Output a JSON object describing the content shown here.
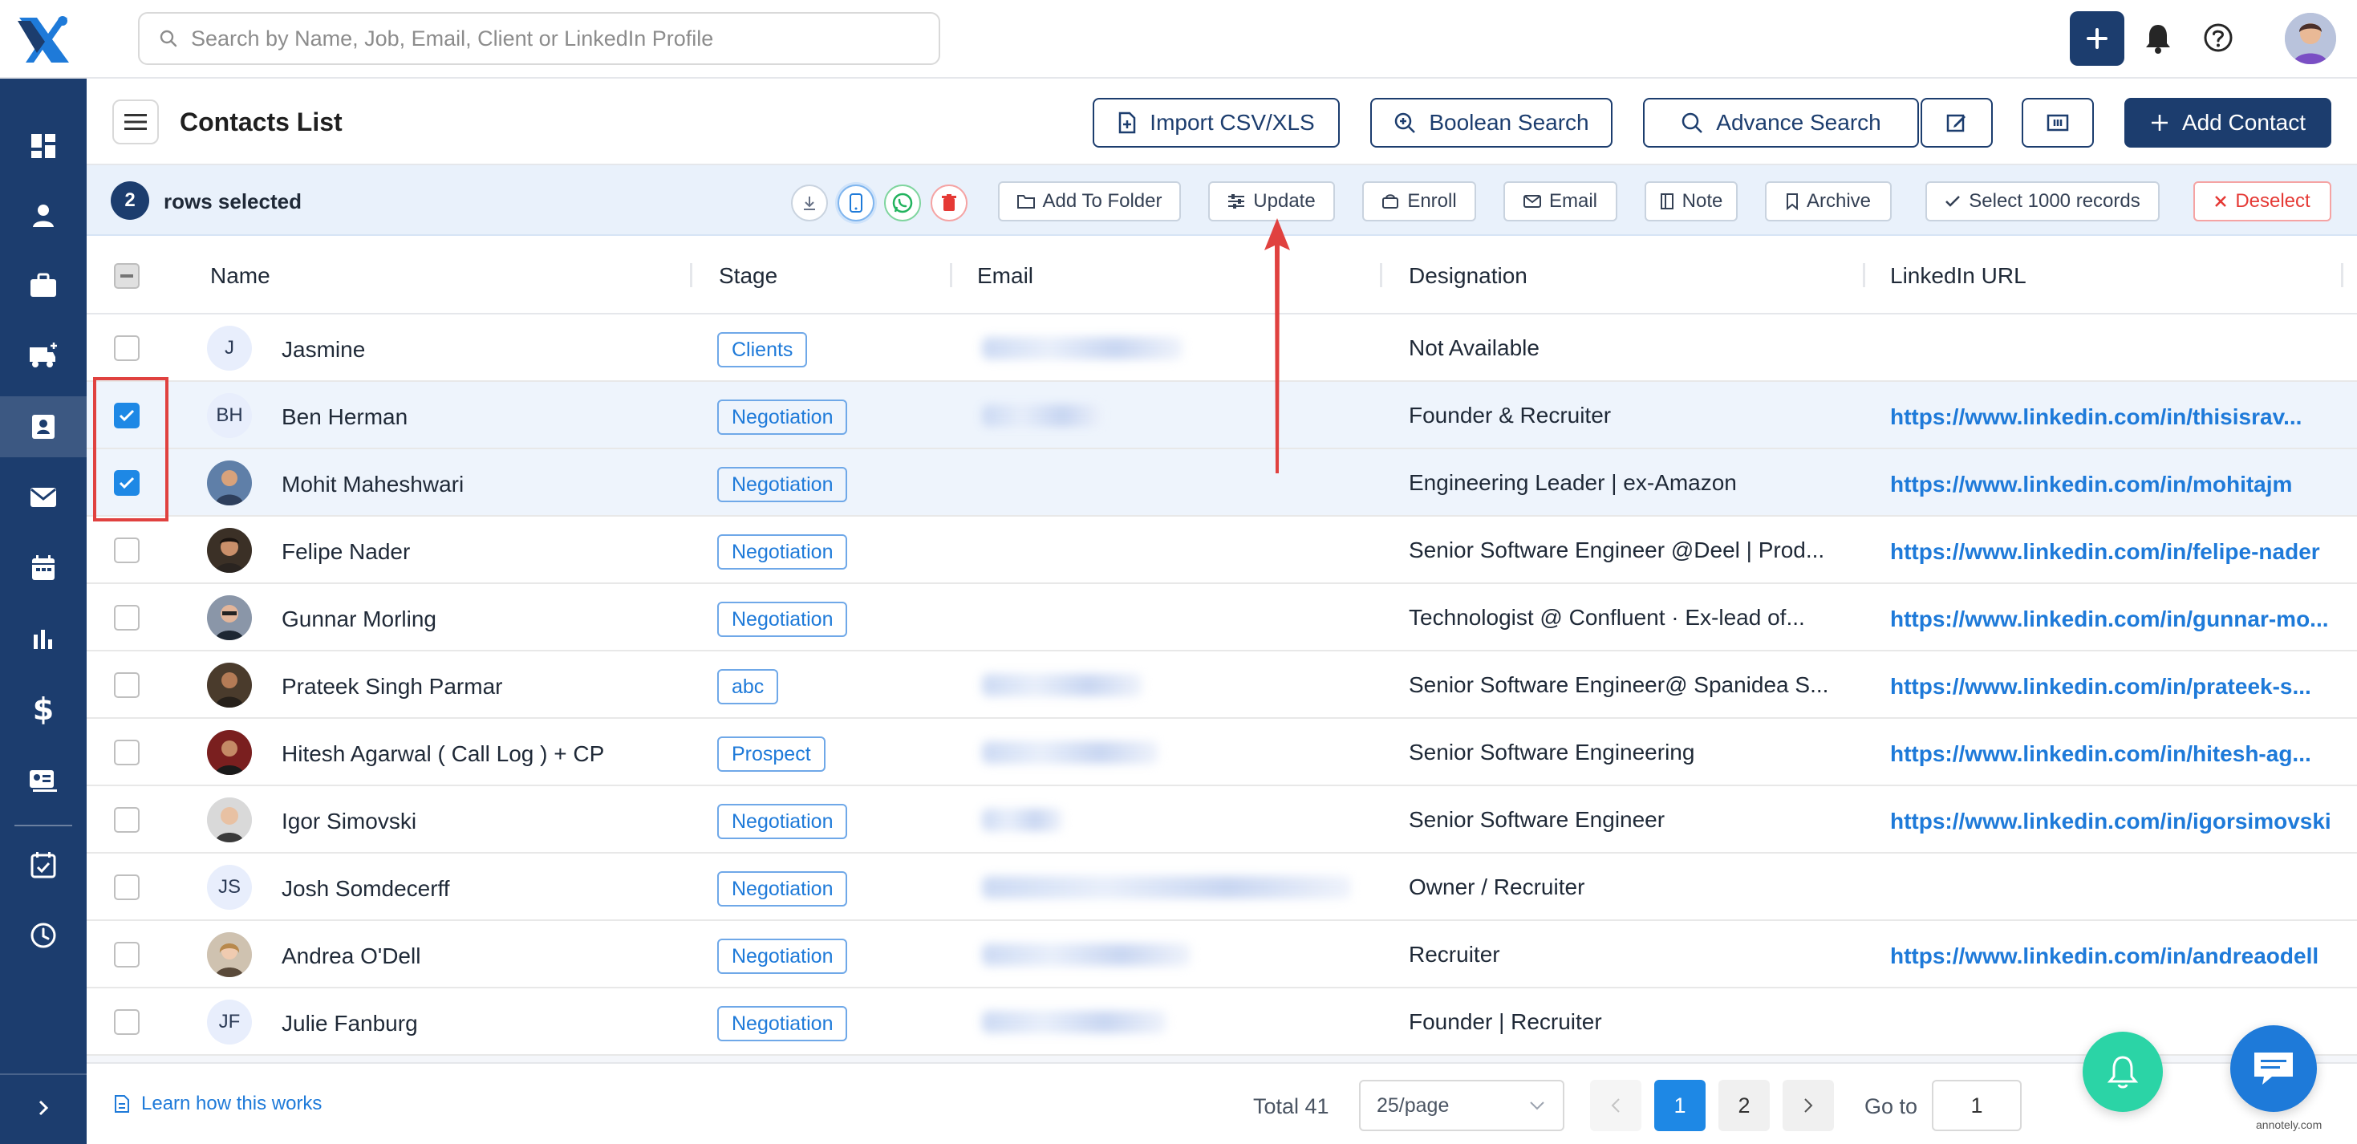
{
  "app": {
    "search_placeholder": "Search by Name, Job, Email, Client or LinkedIn Profile"
  },
  "header": {
    "title": "Contacts List",
    "import_label": "Import CSV/XLS",
    "boolean_label": "Boolean Search",
    "advance_label": "Advance Search",
    "add_contact_label": "Add Contact"
  },
  "selection": {
    "count": "2",
    "text": "rows selected",
    "actions": {
      "add_to_folder": "Add To Folder",
      "update": "Update",
      "enroll": "Enroll",
      "email": "Email",
      "note": "Note",
      "archive": "Archive",
      "select_all": "Select 1000 records",
      "deselect": "Deselect"
    }
  },
  "table": {
    "columns": [
      "Name",
      "Stage",
      "Email",
      "Designation",
      "LinkedIn URL"
    ],
    "rows": [
      {
        "initials": "J",
        "name": "Jasmine",
        "stage": "Clients",
        "designation": "Not Available",
        "linkedin": "",
        "selected": false
      },
      {
        "initials": "BH",
        "name": "Ben Herman",
        "stage": "Negotiation",
        "designation": "Founder & Recruiter",
        "linkedin": "https://www.linkedin.com/in/thisisrav...",
        "selected": true
      },
      {
        "initials": "",
        "name": "Mohit Maheshwari",
        "stage": "Negotiation",
        "designation": "Engineering Leader | ex-Amazon",
        "linkedin": "https://www.linkedin.com/in/mohitajm",
        "selected": true
      },
      {
        "initials": "",
        "name": "Felipe Nader",
        "stage": "Negotiation",
        "designation": "Senior Software Engineer @Deel | Prod...",
        "linkedin": "https://www.linkedin.com/in/felipe-nader",
        "selected": false
      },
      {
        "initials": "",
        "name": "Gunnar Morling",
        "stage": "Negotiation",
        "designation": "Technologist @ Confluent · Ex-lead of...",
        "linkedin": "https://www.linkedin.com/in/gunnar-mo...",
        "selected": false
      },
      {
        "initials": "",
        "name": "Prateek Singh Parmar",
        "stage": "abc",
        "designation": "Senior Software Engineer@ Spanidea S...",
        "linkedin": "https://www.linkedin.com/in/prateek-s...",
        "selected": false
      },
      {
        "initials": "",
        "name": "Hitesh Agarwal ( Call Log ) + CP",
        "stage": "Prospect",
        "designation": "Senior Software Engineering",
        "linkedin": "https://www.linkedin.com/in/hitesh-ag...",
        "selected": false
      },
      {
        "initials": "",
        "name": "Igor Simovski",
        "stage": "Negotiation",
        "designation": "Senior Software Engineer",
        "linkedin": "https://www.linkedin.com/in/igorsimovski",
        "selected": false
      },
      {
        "initials": "JS",
        "name": "Josh Somdecerff",
        "stage": "Negotiation",
        "designation": "Owner / Recruiter",
        "linkedin": "",
        "selected": false
      },
      {
        "initials": "",
        "name": "Andrea O'Dell",
        "stage": "Negotiation",
        "designation": "Recruiter",
        "linkedin": "https://www.linkedin.com/in/andreaodell",
        "selected": false
      },
      {
        "initials": "JF",
        "name": "Julie Fanburg",
        "stage": "Negotiation",
        "designation": "Founder | Recruiter",
        "linkedin": "",
        "selected": false
      }
    ]
  },
  "footer": {
    "learn_link": "Learn how this works",
    "total": "Total 41",
    "per_page": "25/page",
    "pages": [
      "1",
      "2"
    ],
    "goto_label": "Go to",
    "goto_value": "1"
  },
  "watermark": "annotely.com",
  "colors": {
    "brand": "#1c3d6e",
    "accent": "#1e88e5",
    "link": "#1e7ad9",
    "annotation": "#e0413f",
    "fab_bell": "#2bd4a6"
  },
  "icons": {
    "sidebar": [
      "dashboard-icon",
      "person-icon",
      "briefcase-icon",
      "truck-plus-icon",
      "contacts-icon",
      "mail-icon",
      "calendar-icon",
      "bar-chart-icon",
      "dollar-icon",
      "id-card-icon",
      "calendar-check-icon",
      "clock-icon",
      "chevron-right-icon"
    ]
  }
}
